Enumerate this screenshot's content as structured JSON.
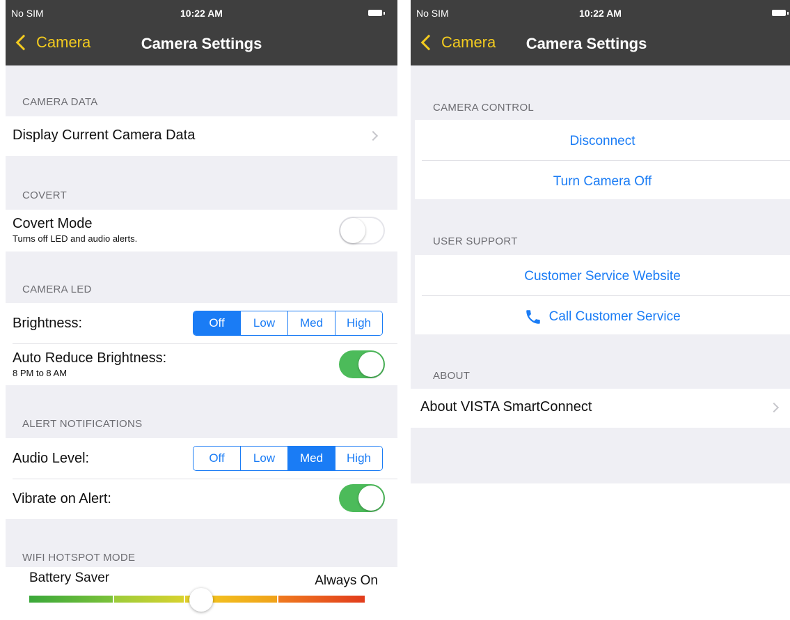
{
  "colors": {
    "nav_bg": "#3f3f3f",
    "accent_yellow": "#f3cb1f",
    "ios_blue": "#1a7cf5",
    "toggle_green": "#4cbb5a"
  },
  "left": {
    "status": {
      "carrier": "No SIM",
      "time": "10:22 AM"
    },
    "nav": {
      "back_label": "Camera",
      "title": "Camera Settings"
    },
    "camera_data": {
      "header": "CAMERA DATA",
      "display_label": "Display Current Camera Data"
    },
    "covert": {
      "header": "COVERT",
      "mode_label": "Covert Mode",
      "mode_sub": "Turns off LED and audio alerts.",
      "mode_on": false
    },
    "camera_led": {
      "header": "CAMERA LED",
      "brightness_label": "Brightness:",
      "brightness_options": [
        "Off",
        "Low",
        "Med",
        "High"
      ],
      "brightness_selected": "Off",
      "auto_reduce_label": "Auto Reduce Brightness:",
      "auto_reduce_sub": "8 PM to 8 AM",
      "auto_reduce_on": true
    },
    "alert_notifications": {
      "header": "ALERT NOTIFICATIONS",
      "audio_label": "Audio Level:",
      "audio_options": [
        "Off",
        "Low",
        "Med",
        "High"
      ],
      "audio_selected": "Med",
      "vibrate_label": "Vibrate on Alert:",
      "vibrate_on": true
    },
    "wifi": {
      "header": "WIFI HOTSPOT MODE",
      "left_label": "Battery Saver",
      "right_label": "Always On",
      "slider_value_fraction": 0.5
    }
  },
  "right": {
    "status": {
      "carrier": "No SIM",
      "time": "10:22 AM"
    },
    "nav": {
      "back_label": "Camera",
      "title": "Camera Settings"
    },
    "camera_control": {
      "header": "CAMERA CONTROL",
      "disconnect": "Disconnect",
      "turn_off": "Turn Camera Off"
    },
    "user_support": {
      "header": "USER SUPPORT",
      "website": "Customer Service Website",
      "call": "Call Customer Service"
    },
    "about": {
      "header": "ABOUT",
      "about_label": "About VISTA SmartConnect"
    }
  }
}
